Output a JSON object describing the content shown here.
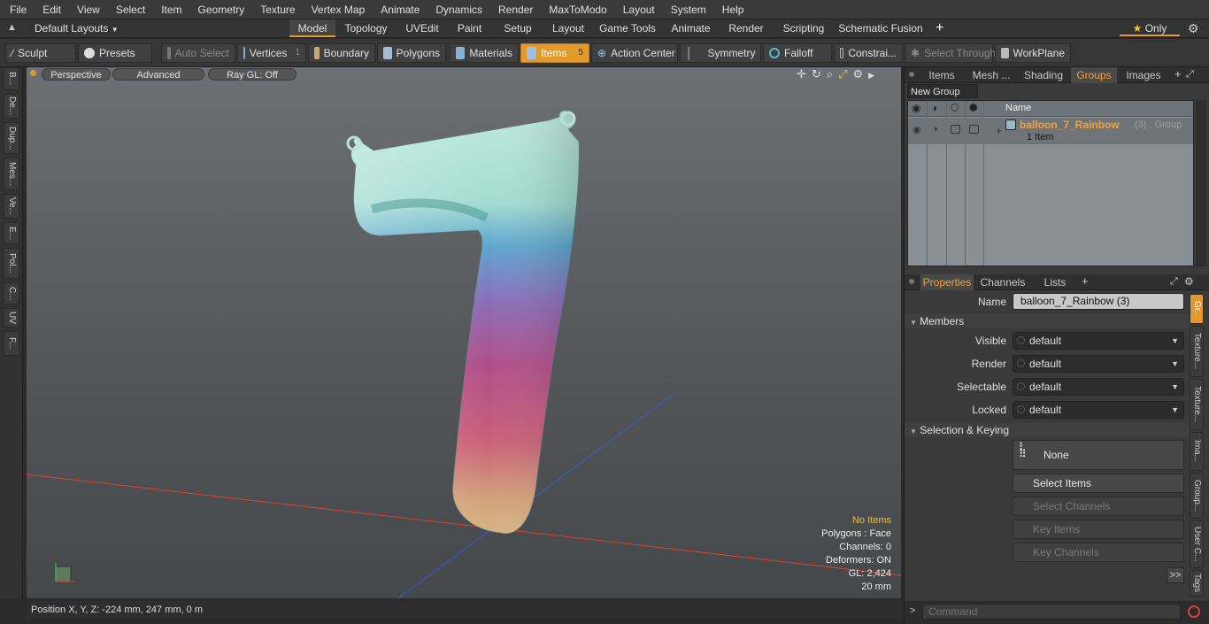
{
  "menu": [
    "File",
    "Edit",
    "View",
    "Select",
    "Item",
    "Geometry",
    "Texture",
    "Vertex Map",
    "Animate",
    "Dynamics",
    "Render",
    "MaxToModo",
    "Layout",
    "System",
    "Help"
  ],
  "layout_dropdown": "Default Layouts",
  "context_tabs": [
    "Model",
    "Topology",
    "UVEdit",
    "Paint",
    "Setup",
    "Layout",
    "Game Tools",
    "Animate",
    "Render",
    "Scripting",
    "Schematic Fusion"
  ],
  "active_context": "Model",
  "only_label": "Only",
  "toolbar": {
    "sculpt": "Sculpt",
    "presets": "Presets",
    "auto_select": "Auto Select",
    "vertices": "Vertices",
    "vertices_count": "1",
    "boundary": "Boundary",
    "polygons": "Polygons",
    "materials": "Materials",
    "items": "Items",
    "items_count": "5",
    "action_center": "Action Center",
    "symmetry": "Symmetry",
    "falloff": "Falloff",
    "constraints": "Constrai...",
    "select_through": "Select Through",
    "workplane": "WorkPlane"
  },
  "left_tabs": [
    "B...",
    "De...",
    "Dup...",
    "Mes...",
    "Ve...",
    "E...",
    "Pol...",
    "C...",
    "UV",
    "F..."
  ],
  "viewport": {
    "view_mode": "Perspective",
    "advanced": "Advanced",
    "raygl": "Ray GL: Off",
    "hud": {
      "no_items": "No Items",
      "polygons": "Polygons : Face",
      "channels": "Channels: 0",
      "deformers": "Deformers: ON",
      "gl": "GL: 2,424",
      "scale": "20 mm"
    },
    "axis_label_z": "Z",
    "axis_label_x": "X"
  },
  "status": {
    "position": "Position X, Y, Z:  -224 mm, 247 mm, 0 m"
  },
  "groups_panel": {
    "tabs": [
      "Items",
      "Mesh ...",
      "Shading",
      "Groups",
      "Images"
    ],
    "active_tab": "Groups",
    "new_group": "New Group",
    "col_name": "Name",
    "group_name": "balloon_7_Rainbow",
    "group_suffix": "(3) : Group",
    "group_items": "1 Item"
  },
  "properties_panel": {
    "tabs": [
      "Properties",
      "Channels",
      "Lists"
    ],
    "active_tab": "Properties",
    "name_label": "Name",
    "name_value": "balloon_7_Rainbow (3)",
    "members_section": "Members",
    "rows": [
      {
        "label": "Visible",
        "value": "default"
      },
      {
        "label": "Render",
        "value": "default"
      },
      {
        "label": "Selectable",
        "value": "default"
      },
      {
        "label": "Locked",
        "value": "default"
      }
    ],
    "selection_section": "Selection & Keying",
    "none_label": "None",
    "select_items": "Select Items",
    "select_channels": "Select Channels",
    "key_items": "Key Items",
    "key_channels": "Key Channels",
    "more": ">>"
  },
  "right_vtabs": [
    "Gr...",
    "Texture...",
    "Texture...",
    "Ima...",
    "Group...",
    "User C...",
    "Tags"
  ],
  "command_placeholder": "Command",
  "colors": {
    "accent": "#e39a2d",
    "group_name": "#f2a23a"
  }
}
